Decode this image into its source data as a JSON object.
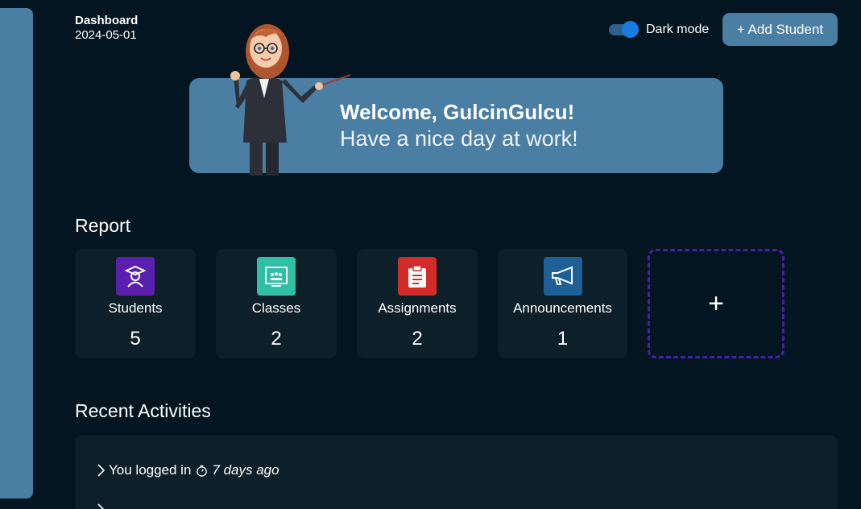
{
  "header": {
    "title": "Dashboard",
    "date": "2024-05-01",
    "dark_mode_label": "Dark mode",
    "add_button_label": "+ Add Student"
  },
  "welcome": {
    "greeting": "Welcome, GulcinGulcu!",
    "subtitle": "Have a nice day at work!"
  },
  "report": {
    "title": "Report",
    "cards": [
      {
        "label": "Students",
        "value": "5",
        "icon": "graduation-cap-icon",
        "color": "#5b1fb0"
      },
      {
        "label": "Classes",
        "value": "2",
        "icon": "classroom-board-icon",
        "color": "#2ebfa5"
      },
      {
        "label": "Assignments",
        "value": "2",
        "icon": "clipboard-icon",
        "color": "#d42a2a"
      },
      {
        "label": "Announcements",
        "value": "1",
        "icon": "megaphone-icon",
        "color": "#1e5f96"
      }
    ],
    "add_card_label": "+"
  },
  "recent": {
    "title": "Recent Activities",
    "items": [
      {
        "text": "You logged in",
        "time": "7 days ago"
      }
    ]
  },
  "colors": {
    "background": "#021520",
    "accent": "#4a7ea3",
    "card": "#0d1f28",
    "toggle_knob": "#1a7be0"
  }
}
